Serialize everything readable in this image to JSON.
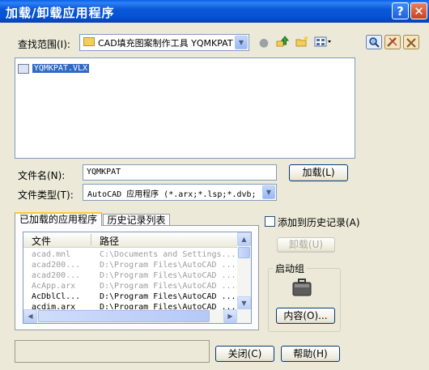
{
  "window": {
    "title": "加载/卸载应用程序"
  },
  "lookin": {
    "label": "查找范围(I):",
    "value": "CAD填充图案制作工具 YQMKPAT"
  },
  "files": [
    {
      "name": "YQMKPAT.VLX"
    }
  ],
  "filename": {
    "label": "文件名(N):",
    "value": "YQMKPAT"
  },
  "filetype": {
    "label": "文件类型(T):",
    "value": "AutoCAD 应用程序 (*.arx;*.lsp;*.dvb;"
  },
  "buttons": {
    "load": "加载(L)",
    "unload": "卸载(U)",
    "contents": "内容(O)...",
    "close": "关闭(C)",
    "help": "帮助(H)"
  },
  "tabs": [
    {
      "label": "已加载的应用程序"
    },
    {
      "label": "历史记录列表"
    }
  ],
  "add_history": {
    "label": "添加到历史记录(A)",
    "checked": false
  },
  "loaded": {
    "columns": [
      "文件",
      "路径"
    ],
    "rows": [
      {
        "file": "acad.mnl",
        "path": "C:\\Documents and Settings...",
        "dim": true
      },
      {
        "file": "acad200...",
        "path": "D:\\Program Files\\AutoCAD ...",
        "dim": true
      },
      {
        "file": "acad200...",
        "path": "D:\\Program Files\\AutoCAD ...",
        "dim": true
      },
      {
        "file": "AcApp.arx",
        "path": "D:\\Program Files\\AutoCAD ...",
        "dim": true
      },
      {
        "file": "AcDblCl...",
        "path": "D:\\Program Files\\AutoCAD ...",
        "dim": false
      },
      {
        "file": "acdim.arx",
        "path": "D:\\Program Files\\AutoCAD ...",
        "dim": false
      }
    ]
  },
  "startup": {
    "label": "启动组"
  },
  "icons": [
    "help-icon",
    "close-icon",
    "folder-icon",
    "back-icon",
    "up-folder-icon",
    "new-folder-icon",
    "views-menu-icon",
    "search-icon",
    "tools-icon",
    "briefcase-icon",
    "file-vlx-icon"
  ]
}
